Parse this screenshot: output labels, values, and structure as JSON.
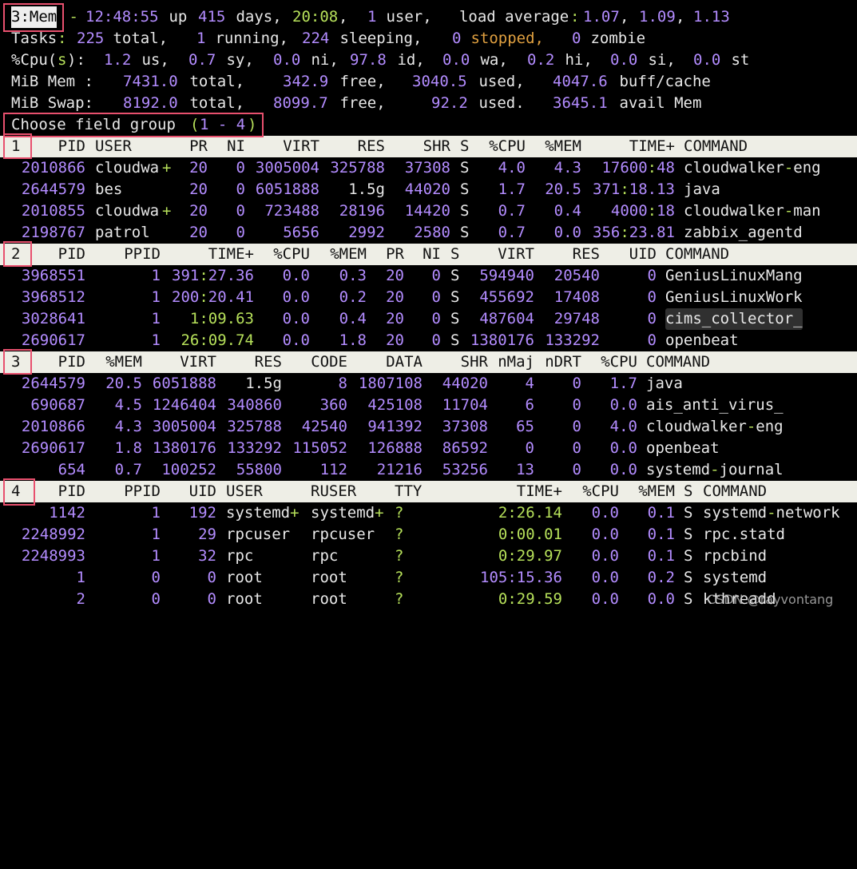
{
  "summary": {
    "window": "3:Mem",
    "dash": " - ",
    "time": "12:48:55",
    "up": " up ",
    "days": "415",
    "days_word": " days, ",
    "hm": "20:08",
    "comma1": ",   ",
    "users": "1",
    "user_word": " user,   load average",
    "colon": ":",
    "l1": "1.07",
    "sep1": ", ",
    "l2": "1.09",
    "sep2": ", ",
    "l3": "1.13"
  },
  "tasks": {
    "label": "Tasks",
    "colon": ":",
    "total": "225",
    "total_word": " total,",
    "running": "1",
    "running_word": " running,",
    "sleeping": "224",
    "sleeping_word": " sleeping,",
    "stopped": "0",
    "stopped_word": " stopped,",
    "zombie": "0",
    "zombie_word": " zombie"
  },
  "cpu": {
    "label_a": "%Cpu(",
    "label_s": "s",
    "label_b": "):",
    "us": "1.2",
    "us_w": " us,",
    "sy": "0.7",
    "sy_w": " sy,",
    "ni": "0.0",
    "ni_w": " ni,",
    "id": "97.8",
    "id_w": " id,",
    "wa": "0.0",
    "wa_w": " wa,",
    "hi": "0.2",
    "hi_w": " hi,",
    "si": "0.0",
    "si_w": " si,",
    "st": "0.0",
    "st_w": " st"
  },
  "mem": {
    "label": "MiB Mem :",
    "total": "7431.0",
    "total_w": " total,",
    "free": "342.9",
    "free_w": " free,",
    "used": "3040.5",
    "used_w": " used,",
    "buff": "4047.6",
    "buff_w": " buff/cache"
  },
  "swap": {
    "label": "MiB Swap:",
    "total": "8192.0",
    "total_w": " total,",
    "free": "8099.7",
    "free_w": " free,",
    "used": "92.2",
    "used_w": " used.",
    "avail": "3645.1",
    "avail_w": " avail Mem"
  },
  "prompt": {
    "text_a": "Choose field group ",
    "text_b": "(",
    "text_c": "1 - 4",
    "text_d": ")"
  },
  "g1": {
    "num": "1",
    "headers": [
      "PID",
      "USER",
      "PR",
      "NI",
      "VIRT",
      "RES",
      "SHR",
      "S",
      "%CPU",
      "%MEM",
      "TIME+",
      "COMMAND"
    ],
    "rows": [
      {
        "pid": "2010866",
        "user": "cloudwa",
        "plus": "+",
        "pr": "20",
        "ni": "0",
        "virt": "3005004",
        "res": "325788",
        "shr": "37308",
        "s": "S",
        "cpu": "4.0",
        "mem": "4.3",
        "time_a": "17600",
        "time_c": ":",
        "time_b": "48",
        "cmd_a": "cloudwalker",
        "cmd_d": "-",
        "cmd_b": "eng"
      },
      {
        "pid": "2644579",
        "user": "bes",
        "plus": "",
        "pr": "20",
        "ni": "0",
        "virt": "6051888",
        "res": "1.5g",
        "shr": "44020",
        "s": "S",
        "cpu": "1.7",
        "mem": "20.5",
        "time_a": "371",
        "time_c": ":",
        "time_b": "18.13",
        "cmd_a": "java",
        "cmd_d": "",
        "cmd_b": ""
      },
      {
        "pid": "2010855",
        "user": "cloudwa",
        "plus": "+",
        "pr": "20",
        "ni": "0",
        "virt": "723488",
        "res": "28196",
        "shr": "14420",
        "s": "S",
        "cpu": "0.7",
        "mem": "0.4",
        "time_a": "4000",
        "time_c": ":",
        "time_b": "18",
        "cmd_a": "cloudwalker",
        "cmd_d": "-",
        "cmd_b": "man"
      },
      {
        "pid": "2198767",
        "user": "patrol",
        "plus": "",
        "pr": "20",
        "ni": "0",
        "virt": "5656",
        "res": "2992",
        "shr": "2580",
        "s": "S",
        "cpu": "0.7",
        "mem": "0.0",
        "time_a": "356",
        "time_c": ":",
        "time_b": "23.81",
        "cmd_a": "zabbix_agentd",
        "cmd_d": "",
        "cmd_b": ""
      }
    ]
  },
  "g2": {
    "num": "2",
    "headers": [
      "PID",
      "PPID",
      "TIME+",
      "%CPU",
      "%MEM",
      "PR",
      "NI",
      "S",
      "VIRT",
      "RES",
      "UID",
      "COMMAND"
    ],
    "rows": [
      {
        "pid": "3968551",
        "ppid": "1",
        "time_a": "391",
        "time_c": ":",
        "time_b": "27.36",
        "cpu": "0.0",
        "mem": "0.3",
        "pr": "20",
        "ni": "0",
        "s": "S",
        "virt": "594940",
        "res": "20540",
        "uid": "0",
        "cmd": "GeniusLinuxMang"
      },
      {
        "pid": "3968512",
        "ppid": "1",
        "time_a": "200",
        "time_c": ":",
        "time_b": "20.41",
        "cpu": "0.0",
        "mem": "0.2",
        "pr": "20",
        "ni": "0",
        "s": "S",
        "virt": "455692",
        "res": "17408",
        "uid": "0",
        "cmd": "GeniusLinuxWork"
      },
      {
        "pid": "3028641",
        "ppid": "1",
        "time_a": "1",
        "time_c": ":",
        "time_b": "09.63",
        "cpu": "0.0",
        "mem": "0.4",
        "pr": "20",
        "ni": "0",
        "s": "S",
        "virt": "487604",
        "res": "29748",
        "uid": "0",
        "cmd": "cims_collector_"
      },
      {
        "pid": "2690617",
        "ppid": "1",
        "time_a": "26",
        "time_c": ":",
        "time_b": "09.74",
        "cpu": "0.0",
        "mem": "1.8",
        "pr": "20",
        "ni": "0",
        "s": "S",
        "virt": "1380176",
        "res": "133292",
        "uid": "0",
        "cmd": "openbeat"
      }
    ]
  },
  "g3": {
    "num": "3",
    "headers": [
      "PID",
      "%MEM",
      "VIRT",
      "RES",
      "CODE",
      "DATA",
      "SHR",
      "nMaj",
      "nDRT",
      "%CPU",
      "COMMAND"
    ],
    "rows": [
      {
        "pid": "2644579",
        "mem": "20.5",
        "virt": "6051888",
        "res": "1.5g",
        "code": "8",
        "data": "1807108",
        "shr": "44020",
        "nmaj": "4",
        "ndrt": "0",
        "cpu": "1.7",
        "cmd_a": "java",
        "cmd_d": "",
        "cmd_b": ""
      },
      {
        "pid": "690687",
        "mem": "4.5",
        "virt": "1246404",
        "res": "340860",
        "code": "360",
        "data": "425108",
        "shr": "11704",
        "nmaj": "6",
        "ndrt": "0",
        "cpu": "0.0",
        "cmd_a": "ais_anti_virus_",
        "cmd_d": "",
        "cmd_b": ""
      },
      {
        "pid": "2010866",
        "mem": "4.3",
        "virt": "3005004",
        "res": "325788",
        "code": "42540",
        "data": "941392",
        "shr": "37308",
        "nmaj": "65",
        "ndrt": "0",
        "cpu": "4.0",
        "cmd_a": "cloudwalker",
        "cmd_d": "-",
        "cmd_b": "eng"
      },
      {
        "pid": "2690617",
        "mem": "1.8",
        "virt": "1380176",
        "res": "133292",
        "code": "115052",
        "data": "126888",
        "shr": "86592",
        "nmaj": "0",
        "ndrt": "0",
        "cpu": "0.0",
        "cmd_a": "openbeat",
        "cmd_d": "",
        "cmd_b": ""
      },
      {
        "pid": "654",
        "mem": "0.7",
        "virt": "100252",
        "res": "55800",
        "code": "112",
        "data": "21216",
        "shr": "53256",
        "nmaj": "13",
        "ndrt": "0",
        "cpu": "0.0",
        "cmd_a": "systemd",
        "cmd_d": "-",
        "cmd_b": "journal"
      }
    ]
  },
  "g4": {
    "num": "4",
    "headers": [
      "PID",
      "PPID",
      "UID",
      "USER",
      "RUSER",
      "TTY",
      "TIME+",
      "%CPU",
      "%MEM",
      "S",
      "COMMAND"
    ],
    "rows": [
      {
        "pid": "1142",
        "ppid": "1",
        "uid": "192",
        "user": "systemd",
        "uplus": "+",
        "ruser": "systemd",
        "rplus": "+",
        "tty": "?",
        "time": "2:26.14",
        "cpu": "0.0",
        "mem": "0.1",
        "s": "S",
        "cmd_a": "systemd",
        "cmd_d": "-",
        "cmd_b": "network"
      },
      {
        "pid": "2248992",
        "ppid": "1",
        "uid": "29",
        "user": "rpcuser",
        "uplus": "",
        "ruser": "rpcuser",
        "rplus": "",
        "tty": "?",
        "time": "0:00.01",
        "cpu": "0.0",
        "mem": "0.1",
        "s": "S",
        "cmd_a": "rpc.statd",
        "cmd_d": "",
        "cmd_b": ""
      },
      {
        "pid": "2248993",
        "ppid": "1",
        "uid": "32",
        "user": "rpc",
        "uplus": "",
        "ruser": "rpc",
        "rplus": "",
        "tty": "?",
        "time": "0:29.97",
        "cpu": "0.0",
        "mem": "0.1",
        "s": "S",
        "cmd_a": "rpcbind",
        "cmd_d": "",
        "cmd_b": ""
      },
      {
        "pid": "1",
        "ppid": "0",
        "uid": "0",
        "user": "root",
        "uplus": "",
        "ruser": "root",
        "rplus": "",
        "tty": "?",
        "time": "105:15.36",
        "cpu": "0.0",
        "mem": "0.2",
        "s": "S",
        "cmd_a": "systemd",
        "cmd_d": "",
        "cmd_b": ""
      },
      {
        "pid": "2",
        "ppid": "0",
        "uid": "0",
        "user": "root",
        "uplus": "",
        "ruser": "root",
        "rplus": "",
        "tty": "?",
        "time": "0:29.59",
        "cpu": "0.0",
        "mem": "0.0",
        "s": "S",
        "cmd_a": "kthreadd",
        "cmd_d": "",
        "cmd_b": ""
      }
    ]
  },
  "watermark": "CSDN @rayvontang",
  "colors": {
    "background": "#000000",
    "text": "#e6e6e6",
    "number": "#b38cff",
    "accent_green": "#b6e05a",
    "stopped_orange": "#e0a040",
    "header_bg": "#eeeee6",
    "annotation_box": "#e8506e"
  }
}
